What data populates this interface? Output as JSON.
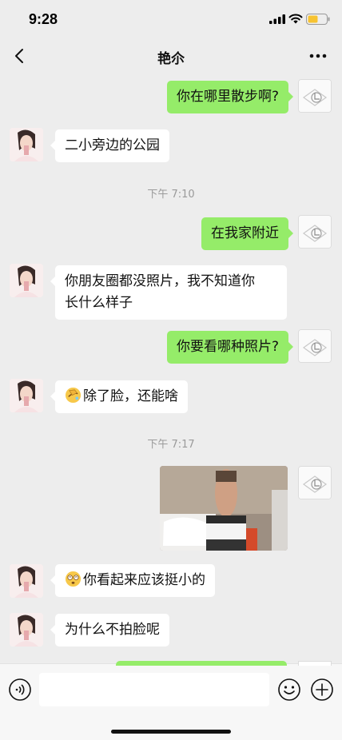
{
  "status_bar": {
    "time": "9:28"
  },
  "header": {
    "title": "艳尒",
    "back_icon": "chevron-left-icon",
    "more_icon": "more-dots-icon"
  },
  "messages": [
    {
      "from": "me",
      "text": "你在哪里散步啊?"
    },
    {
      "from": "contact",
      "text": "二小旁边的公园"
    },
    {
      "type": "time",
      "text": "下午 7:10"
    },
    {
      "from": "me",
      "text": "在我家附近"
    },
    {
      "from": "contact",
      "lines": [
        "你朋友圈都没照片，我不知道你",
        "长什么样子"
      ]
    },
    {
      "from": "me",
      "text": "你要看哪种照片?"
    },
    {
      "from": "contact",
      "emoji": "facepalm-emoji",
      "text": "除了脸，还能啥"
    },
    {
      "type": "time",
      "text": "下午 7:17"
    },
    {
      "from": "me",
      "type": "image",
      "image_icon": "photo-thumbnail"
    },
    {
      "from": "contact",
      "emoji": "dizzy-face-emoji",
      "text": "你看起来应该挺小的"
    },
    {
      "from": "contact",
      "text": "为什么不拍脸呢"
    }
  ],
  "input_bar": {
    "voice_icon": "voice-icon",
    "emoji_icon": "emoji-icon",
    "plus_icon": "plus-icon",
    "placeholder": ""
  },
  "colors": {
    "background": "#ededed",
    "my_bubble": "#95ec69",
    "their_bubble": "#ffffff",
    "timestamp": "#9a9a9a"
  }
}
